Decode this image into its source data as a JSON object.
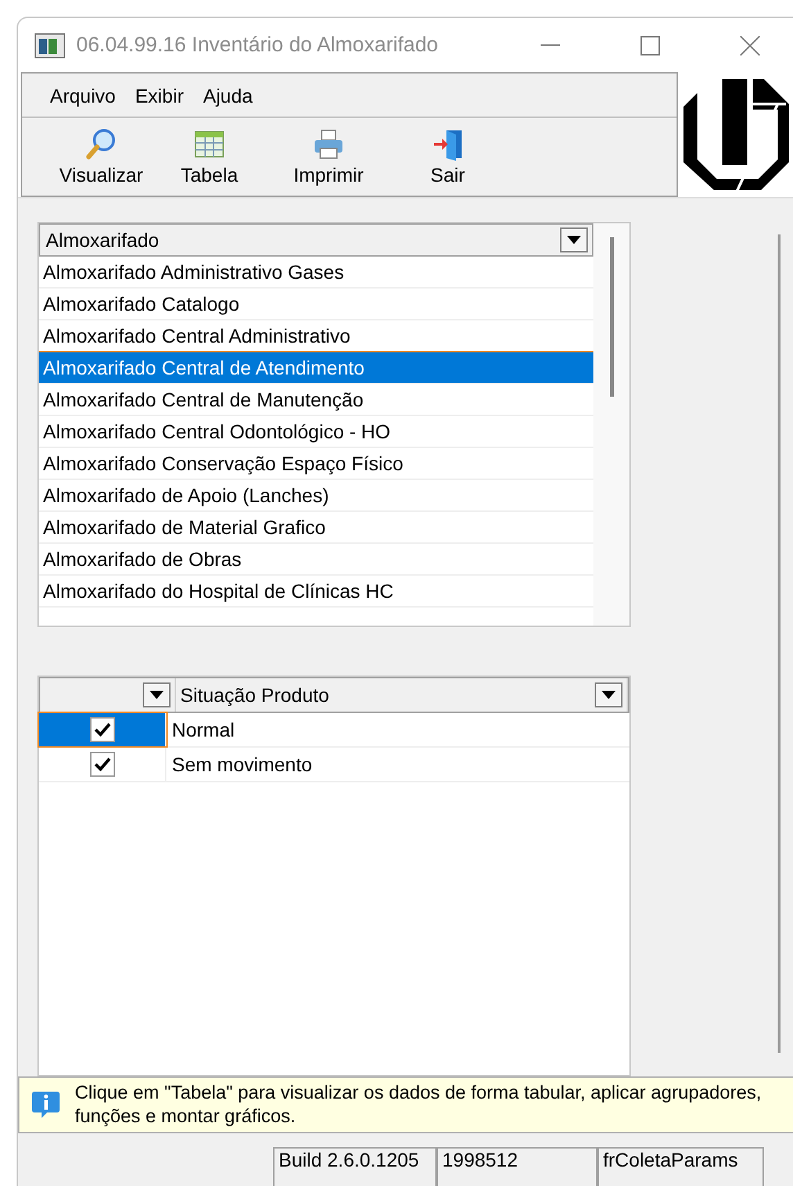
{
  "window": {
    "title": "06.04.99.16 Inventário do Almoxarifado"
  },
  "menu": [
    "Arquivo",
    "Exibir",
    "Ajuda"
  ],
  "toolbar": [
    {
      "kind": "search",
      "label": "Visualizar"
    },
    {
      "kind": "table",
      "label": "Tabela"
    },
    {
      "kind": "print",
      "label": "Imprimir"
    },
    {
      "kind": "exit",
      "label": "Sair"
    }
  ],
  "almoxarifado": {
    "column": "Almoxarifado",
    "rows": [
      {
        "label": "Almoxarifado Administrativo Gases",
        "selected": false
      },
      {
        "label": "Almoxarifado Catalogo",
        "selected": false
      },
      {
        "label": "Almoxarifado Central Administrativo",
        "selected": false
      },
      {
        "label": "Almoxarifado Central de Atendimento",
        "selected": true
      },
      {
        "label": "Almoxarifado Central de Manutenção",
        "selected": false
      },
      {
        "label": "Almoxarifado Central Odontológico - HO",
        "selected": false
      },
      {
        "label": "Almoxarifado Conservação Espaço Físico",
        "selected": false
      },
      {
        "label": "Almoxarifado de Apoio (Lanches)",
        "selected": false
      },
      {
        "label": "Almoxarifado de Material Grafico",
        "selected": false
      },
      {
        "label": "Almoxarifado de Obras",
        "selected": false
      },
      {
        "label": "Almoxarifado do Hospital de Clínicas HC",
        "selected": false
      }
    ]
  },
  "situacao": {
    "column": "Situação Produto",
    "rows": [
      {
        "label": "Normal",
        "checked": true,
        "selected": true
      },
      {
        "label": "Sem movimento",
        "checked": true,
        "selected": false
      }
    ]
  },
  "info": "Clique em \"Tabela\" para visualizar os dados de forma tabular, aplicar agrupadores, funções e montar gráficos.",
  "status_bar": [
    "Build 2.6.0.1205",
    "1998512",
    "frColetaParams"
  ]
}
